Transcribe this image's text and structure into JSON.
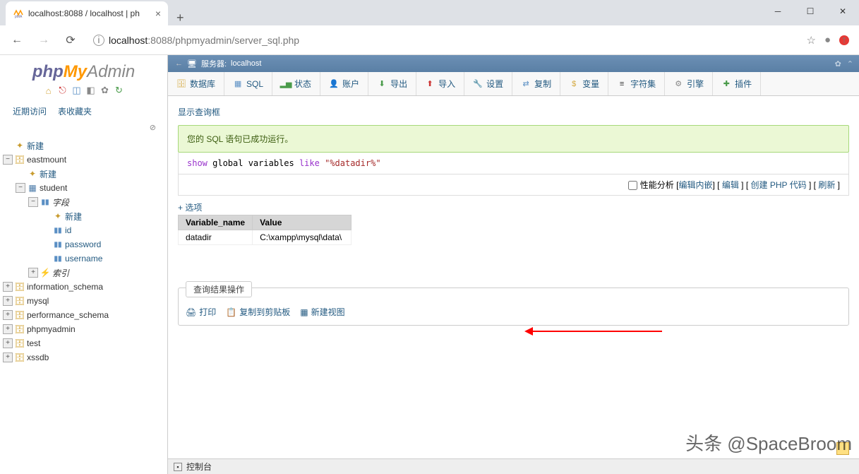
{
  "browser": {
    "tab_title": "localhost:8088 / localhost | ph",
    "url_host": "localhost",
    "url_path": ":8088/phpmyadmin/server_sql.php",
    "new_tab": "+"
  },
  "logo": {
    "php": "php",
    "my": "My",
    "admin": "Admin"
  },
  "side_tabs": {
    "recent": "近期访问",
    "favorites": "表收藏夹"
  },
  "tree": {
    "new_root": "新建",
    "db1": "eastmount",
    "db1_new": "新建",
    "tbl1": "student",
    "cols_label": "字段",
    "col_new": "新建",
    "col1": "id",
    "col2": "password",
    "col3": "username",
    "idx": "索引",
    "db2": "information_schema",
    "db3": "mysql",
    "db4": "performance_schema",
    "db5": "phpmyadmin",
    "db6": "test",
    "db7": "xssdb"
  },
  "server_bar": {
    "label": "服务器:",
    "name": "localhost"
  },
  "top_tabs": {
    "databases": "数据库",
    "sql": "SQL",
    "status": "状态",
    "accounts": "账户",
    "export": "导出",
    "import": "导入",
    "settings": "设置",
    "replication": "复制",
    "variables": "变量",
    "charsets": "字符集",
    "engines": "引擎",
    "plugins": "插件"
  },
  "content": {
    "show_query": "显示查询框",
    "success_msg": "您的 SQL 语句已成功运行。",
    "sql_show": "show",
    "sql_global_vars": " global variables ",
    "sql_like": "like",
    "sql_str": " \"%datadir%\"",
    "perf_analysis": "性能分析",
    "edit_inline": "编辑内嵌",
    "edit": "编辑",
    "create_php": "创建 PHP 代码",
    "refresh": "刷新",
    "options": "+ 选项",
    "col_varname": "Variable_name",
    "col_value": "Value",
    "row_varname": "datadir",
    "row_value": "C:\\xampp\\mysql\\data\\",
    "ops_title": "查询结果操作",
    "print": "打印",
    "copy_clipboard": "复制到剪贴板",
    "new_view": "新建视图",
    "console": "控制台"
  },
  "watermark": "头条 @SpaceBroom"
}
